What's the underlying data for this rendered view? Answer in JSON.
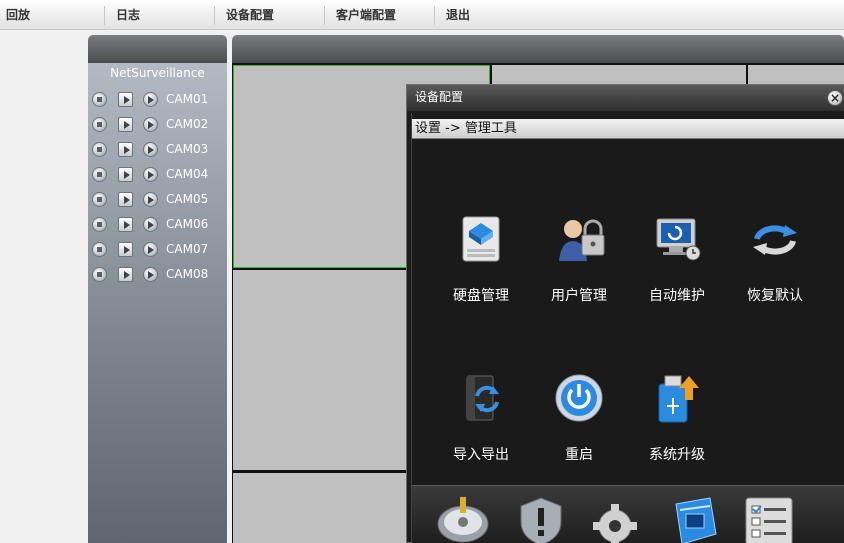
{
  "menu": {
    "items": [
      "回放",
      "日志",
      "设备配置",
      "客户端配置",
      "退出"
    ]
  },
  "device_panel": {
    "device_name": "NetSurveillance",
    "cameras": [
      "CAM01",
      "CAM02",
      "CAM03",
      "CAM04",
      "CAM05",
      "CAM06",
      "CAM07",
      "CAM08"
    ]
  },
  "dialog": {
    "title": "设备配置",
    "close_icon": "close-icon",
    "breadcrumb": "设置 -> 管理工具",
    "tools": [
      {
        "label": "硬盘管理",
        "icon": "hard-disk-icon"
      },
      {
        "label": "用户管理",
        "icon": "user-lock-icon"
      },
      {
        "label": "自动维护",
        "icon": "monitor-clock-icon"
      },
      {
        "label": "恢复默认",
        "icon": "restore-arrows-icon"
      },
      {
        "label": "导入导出",
        "icon": "import-export-icon"
      },
      {
        "label": "重启",
        "icon": "power-restart-icon"
      },
      {
        "label": "系统升级",
        "icon": "usb-upgrade-icon"
      }
    ],
    "taskbar": [
      "disk-icon",
      "shield-alert-icon",
      "gear-icon",
      "network-icon",
      "checklist-icon"
    ]
  },
  "colors": {
    "selected_cell_border": "#2fb82f",
    "dialog_background": "#1c1c1c",
    "accent_blue": "#2a8be0"
  }
}
